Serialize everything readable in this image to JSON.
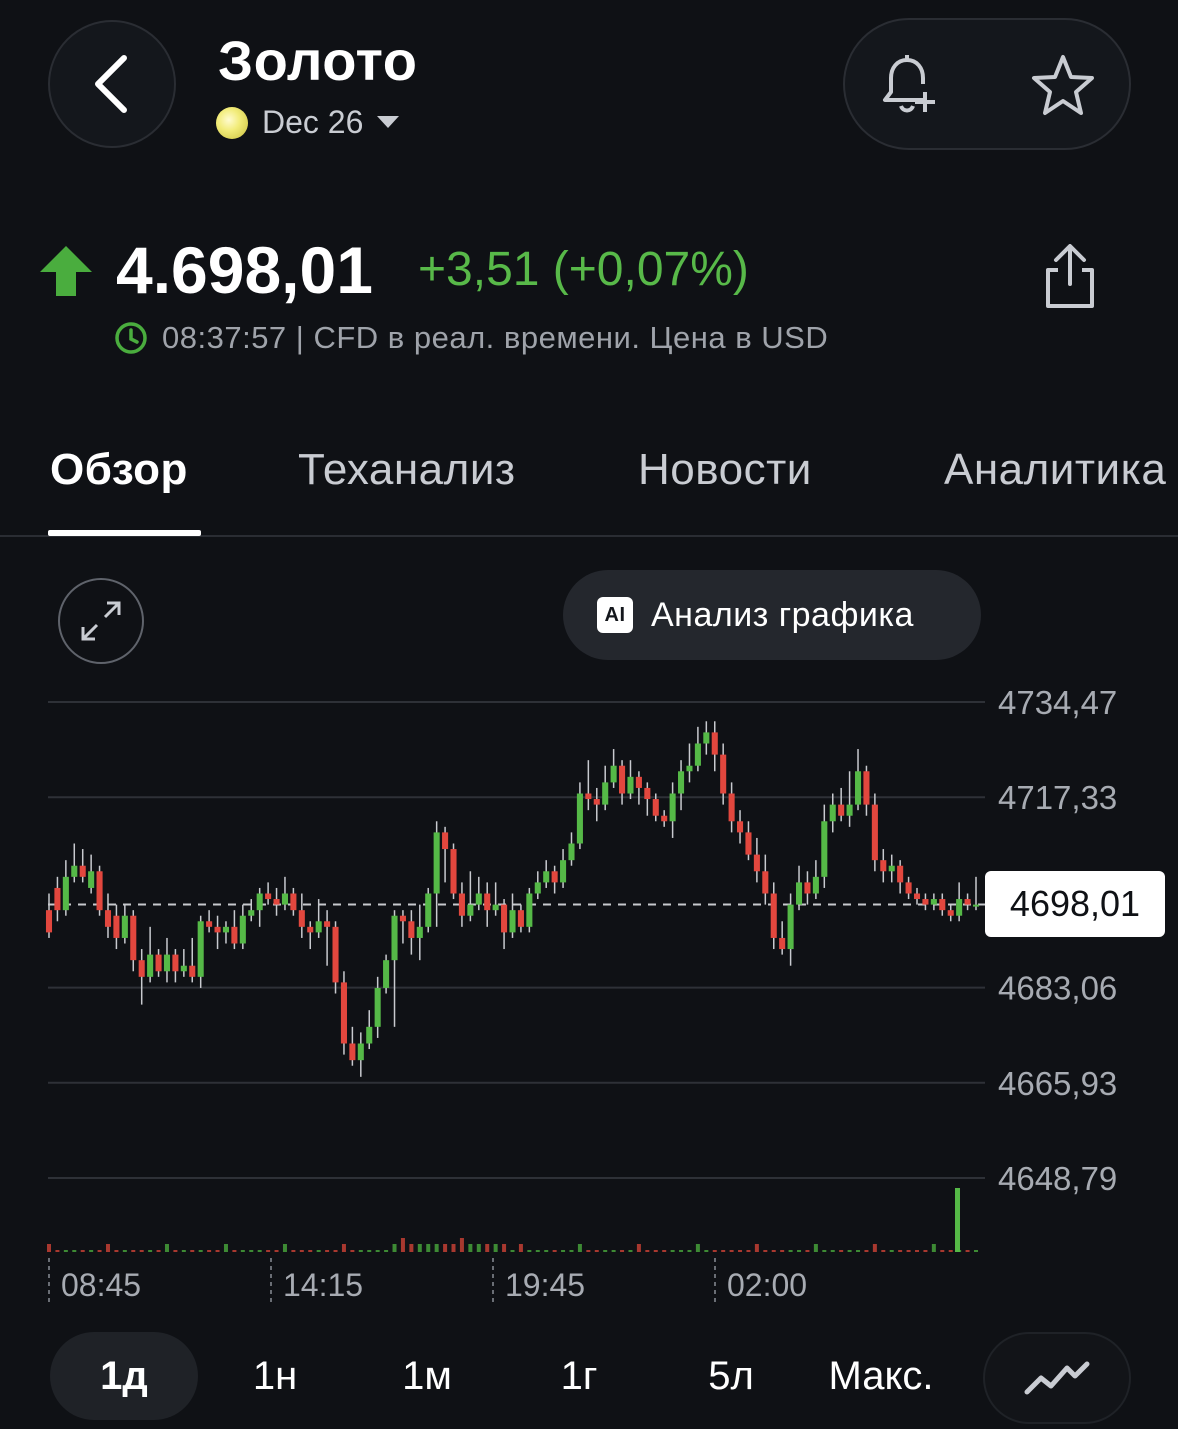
{
  "header": {
    "title": "Золото",
    "contract": "Dec 26"
  },
  "quote": {
    "price": "4.698,01",
    "change": "+3,51 (+0,07%)",
    "info": "08:37:57 | CFD в реал. времени. Цена в USD",
    "direction": "up"
  },
  "tabs": [
    "Обзор",
    "Теханализ",
    "Новости",
    "Аналитика"
  ],
  "chart_controls": {
    "ai_label": "Анализ графика",
    "ai_badge": "AI",
    "current_price_label": "4698,01"
  },
  "chart_data": {
    "type": "candlestick",
    "y_ticks": [
      "4734,47",
      "4717,33",
      "4683,06",
      "4665,93",
      "4648,79"
    ],
    "ylim": [
      4648.79,
      4734.47
    ],
    "x_ticks": [
      "08:45",
      "14:15",
      "19:45",
      "02:00"
    ],
    "current_price": 4698.01,
    "colors": {
      "up": "#55b947",
      "down": "#e2473e"
    },
    "candles": [
      [
        4697,
        4693,
        4700,
        4692
      ],
      [
        4701,
        4697,
        4703,
        4695
      ],
      [
        4697,
        4703,
        4706,
        4696
      ],
      [
        4703,
        4705,
        4709,
        4702
      ],
      [
        4705,
        4703,
        4708,
        4702
      ],
      [
        4701,
        4704,
        4707,
        4700
      ],
      [
        4704,
        4697,
        4705,
        4696
      ],
      [
        4697,
        4694,
        4700,
        4692
      ],
      [
        4696,
        4692,
        4698,
        4690
      ],
      [
        4692,
        4696,
        4698,
        4691
      ],
      [
        4696,
        4688,
        4697,
        4686
      ],
      [
        4688,
        4685,
        4690,
        4680
      ],
      [
        4685,
        4689,
        4694,
        4684
      ],
      [
        4689,
        4686,
        4690,
        4685
      ],
      [
        4686,
        4689,
        4692,
        4684
      ],
      [
        4689,
        4686,
        4690,
        4684
      ],
      [
        4686,
        4687,
        4690,
        4685
      ],
      [
        4687,
        4685,
        4692,
        4684
      ],
      [
        4685,
        4695,
        4696,
        4683
      ],
      [
        4695,
        4694,
        4697,
        4693
      ],
      [
        4694,
        4693,
        4696,
        4690
      ],
      [
        4693,
        4694,
        4695,
        4691
      ],
      [
        4694,
        4691,
        4697,
        4690
      ],
      [
        4691,
        4696,
        4698,
        4690
      ],
      [
        4696,
        4697,
        4699,
        4695
      ],
      [
        4697,
        4700,
        4701,
        4694
      ],
      [
        4700,
        4699,
        4702,
        4698
      ],
      [
        4699,
        4698,
        4701,
        4696
      ],
      [
        4698,
        4700,
        4703,
        4697
      ],
      [
        4700,
        4697,
        4701,
        4696
      ],
      [
        4697,
        4694,
        4700,
        4692
      ],
      [
        4694,
        4693,
        4695,
        4690
      ],
      [
        4693,
        4695,
        4699,
        4692
      ],
      [
        4695,
        4694,
        4697,
        4687
      ],
      [
        4694,
        4684,
        4695,
        4682
      ],
      [
        4684,
        4673,
        4686,
        4671
      ],
      [
        4673,
        4670,
        4676,
        4669
      ],
      [
        4670,
        4673,
        4675,
        4667
      ],
      [
        4673,
        4676,
        4679,
        4672
      ],
      [
        4676,
        4683,
        4685,
        4674
      ],
      [
        4683,
        4688,
        4689,
        4682
      ],
      [
        4688,
        4696,
        4697,
        4676
      ],
      [
        4696,
        4695,
        4697,
        4691
      ],
      [
        4695,
        4692,
        4697,
        4689
      ],
      [
        4692,
        4694,
        4698,
        4688
      ],
      [
        4694,
        4700,
        4701,
        4693
      ],
      [
        4700,
        4711,
        4713,
        4694
      ],
      [
        4711,
        4708,
        4712,
        4702
      ],
      [
        4708,
        4700,
        4709,
        4699
      ],
      [
        4700,
        4696,
        4702,
        4694
      ],
      [
        4696,
        4698,
        4704,
        4695
      ],
      [
        4698,
        4700,
        4703,
        4697
      ],
      [
        4700,
        4697,
        4702,
        4694
      ],
      [
        4697,
        4698,
        4702,
        4696
      ],
      [
        4698,
        4693,
        4699,
        4690
      ],
      [
        4693,
        4697,
        4700,
        4692
      ],
      [
        4697,
        4694,
        4698,
        4693
      ],
      [
        4694,
        4700,
        4701,
        4693
      ],
      [
        4700,
        4702,
        4704,
        4699
      ],
      [
        4702,
        4704,
        4706,
        4701
      ],
      [
        4704,
        4702,
        4705,
        4700
      ],
      [
        4702,
        4706,
        4708,
        4701
      ],
      [
        4706,
        4709,
        4711,
        4705
      ],
      [
        4709,
        4718,
        4720,
        4708
      ],
      [
        4718,
        4717,
        4724,
        4715
      ],
      [
        4717,
        4716,
        4719,
        4713
      ],
      [
        4716,
        4720,
        4723,
        4715
      ],
      [
        4720,
        4723,
        4726,
        4719
      ],
      [
        4723,
        4718,
        4724,
        4716
      ],
      [
        4718,
        4721,
        4724,
        4717
      ],
      [
        4721,
        4719,
        4722,
        4716
      ],
      [
        4719,
        4717,
        4720,
        4714
      ],
      [
        4717,
        4714,
        4718,
        4713
      ],
      [
        4714,
        4713,
        4715,
        4712
      ],
      [
        4713,
        4718,
        4720,
        4710
      ],
      [
        4718,
        4722,
        4724,
        4715
      ],
      [
        4722,
        4723,
        4727,
        4720
      ],
      [
        4723,
        4727,
        4730,
        4722
      ],
      [
        4727,
        4729,
        4731,
        4725
      ],
      [
        4729,
        4725,
        4731,
        4722
      ],
      [
        4725,
        4718,
        4727,
        4716
      ],
      [
        4718,
        4713,
        4720,
        4711
      ],
      [
        4713,
        4711,
        4715,
        4709
      ],
      [
        4711,
        4707,
        4713,
        4706
      ],
      [
        4707,
        4704,
        4710,
        4702
      ],
      [
        4704,
        4700,
        4707,
        4698
      ],
      [
        4700,
        4692,
        4702,
        4690
      ],
      [
        4692,
        4690,
        4695,
        4689
      ],
      [
        4690,
        4698,
        4700,
        4687
      ],
      [
        4698,
        4702,
        4705,
        4697
      ],
      [
        4702,
        4700,
        4704,
        4698
      ],
      [
        4700,
        4703,
        4706,
        4699
      ],
      [
        4703,
        4713,
        4716,
        4701
      ],
      [
        4713,
        4716,
        4718,
        4711
      ],
      [
        4716,
        4714,
        4719,
        4713
      ],
      [
        4714,
        4716,
        4722,
        4712
      ],
      [
        4716,
        4722,
        4726,
        4715
      ],
      [
        4722,
        4716,
        4723,
        4714
      ],
      [
        4716,
        4706,
        4718,
        4704
      ],
      [
        4706,
        4704,
        4708,
        4702
      ],
      [
        4704,
        4705,
        4707,
        4702
      ],
      [
        4705,
        4702,
        4706,
        4700
      ],
      [
        4702,
        4700,
        4703,
        4699
      ],
      [
        4700,
        4699,
        4701,
        4698
      ],
      [
        4699,
        4698,
        4700,
        4697
      ],
      [
        4698,
        4699,
        4700,
        4697
      ],
      [
        4699,
        4697,
        4700,
        4696
      ],
      [
        4697,
        4696,
        4698,
        4695
      ],
      [
        4696,
        4699,
        4702,
        4695
      ],
      [
        4699,
        4698,
        4700,
        4697
      ],
      [
        4698,
        4698,
        4703,
        4697
      ]
    ],
    "volume_spike": {
      "position": "last",
      "relative_height": 1.0
    }
  },
  "timeframes": {
    "options": [
      "1д",
      "1н",
      "1м",
      "1г",
      "5л",
      "Макс."
    ],
    "selected": "1д"
  },
  "icons": {
    "back": "chevron-left-icon",
    "alert": "bell-plus-icon",
    "watchlist": "star-icon",
    "share": "share-icon",
    "clock": "clock-icon",
    "expand": "expand-icon",
    "chart_type": "line-chart-icon",
    "price_arrow": "arrow-up-icon"
  }
}
